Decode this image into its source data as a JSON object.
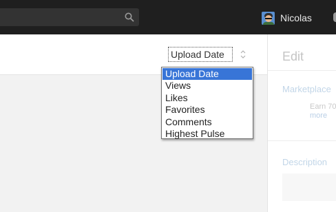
{
  "header": {
    "search": {
      "value": "",
      "icon": "search-icon"
    },
    "user": {
      "name": "Nicolas",
      "avatar_icon": "avatar-icon"
    }
  },
  "main": {
    "sort_select": {
      "selected": "Upload Date",
      "options": [
        "Upload Date",
        "Views",
        "Likes",
        "Favorites",
        "Comments",
        "Highest Pulse"
      ]
    }
  },
  "panel": {
    "title": "Edit",
    "marketplace": {
      "label": "Marketplace",
      "text": "Earn 70",
      "link": "more"
    },
    "description": {
      "label": "Description"
    }
  },
  "colors": {
    "topbar": "#1f1f1f",
    "selection": "#3875d7",
    "link": "#b9cfe6"
  }
}
